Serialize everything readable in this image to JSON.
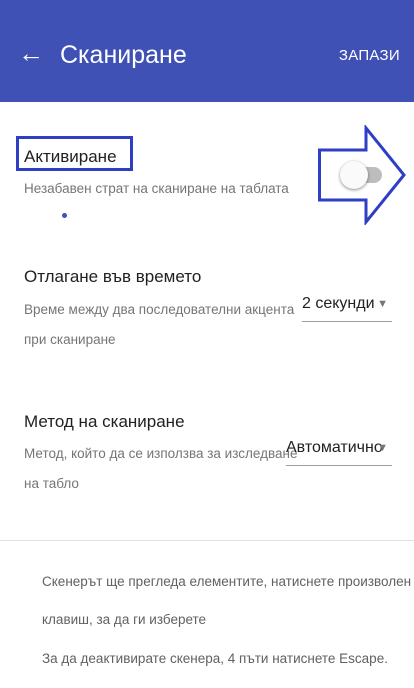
{
  "appbar": {
    "back_icon": "arrow-left-icon",
    "title": "Сканиране",
    "save_label": "ЗАПАЗИ"
  },
  "activate": {
    "title": "Активиране",
    "description": "Незабавен страт на сканиране на таблата",
    "toggle_on": false
  },
  "delay": {
    "title": "Отлагане във времето",
    "description_line1": "Време между два последователни акцента",
    "description_line2": "при сканиране",
    "selected": "2 секунди"
  },
  "method": {
    "title": "Метод на сканиране",
    "description_line1": "Метод, който да се използва за изследване",
    "description_line2": "на табло",
    "selected": "Автоматично"
  },
  "footer": {
    "line1": "Скенерът ще прегледа елементите, натиснете произволен",
    "line2": "клавиш, за да ги изберете",
    "line3": "За да деактивирате скенера, 4 пъти натиснете Escape."
  },
  "colors": {
    "primary": "#3f51b5",
    "highlight": "#2f3fc4"
  }
}
